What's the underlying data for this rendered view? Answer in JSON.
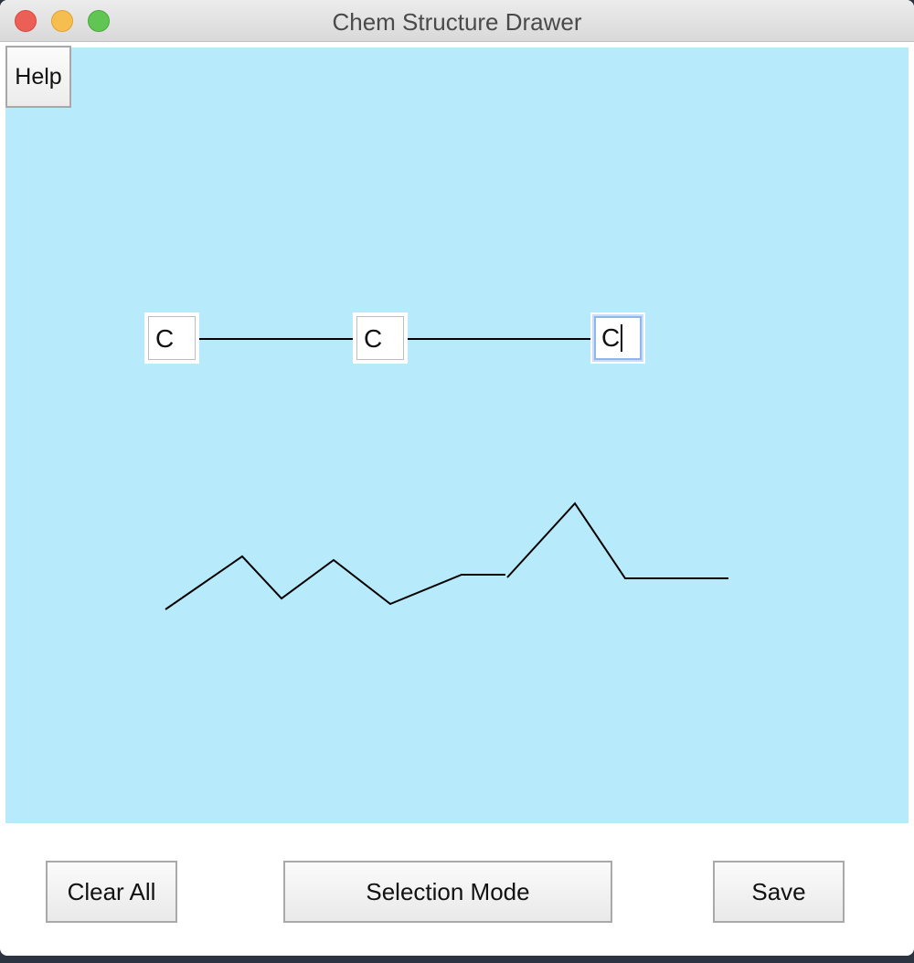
{
  "window": {
    "title": "Chem Structure Drawer"
  },
  "toolbar": {
    "help_label": "Help"
  },
  "atoms": [
    {
      "symbol": "C"
    },
    {
      "symbol": "C"
    },
    {
      "symbol": "C"
    }
  ],
  "footer": {
    "clear_label": "Clear All",
    "selection_label": "Selection Mode",
    "save_label": "Save"
  },
  "colors": {
    "canvas_background": "#b7ebfb",
    "bond_color": "#000000",
    "focus_ring": "#8fb7ee"
  }
}
